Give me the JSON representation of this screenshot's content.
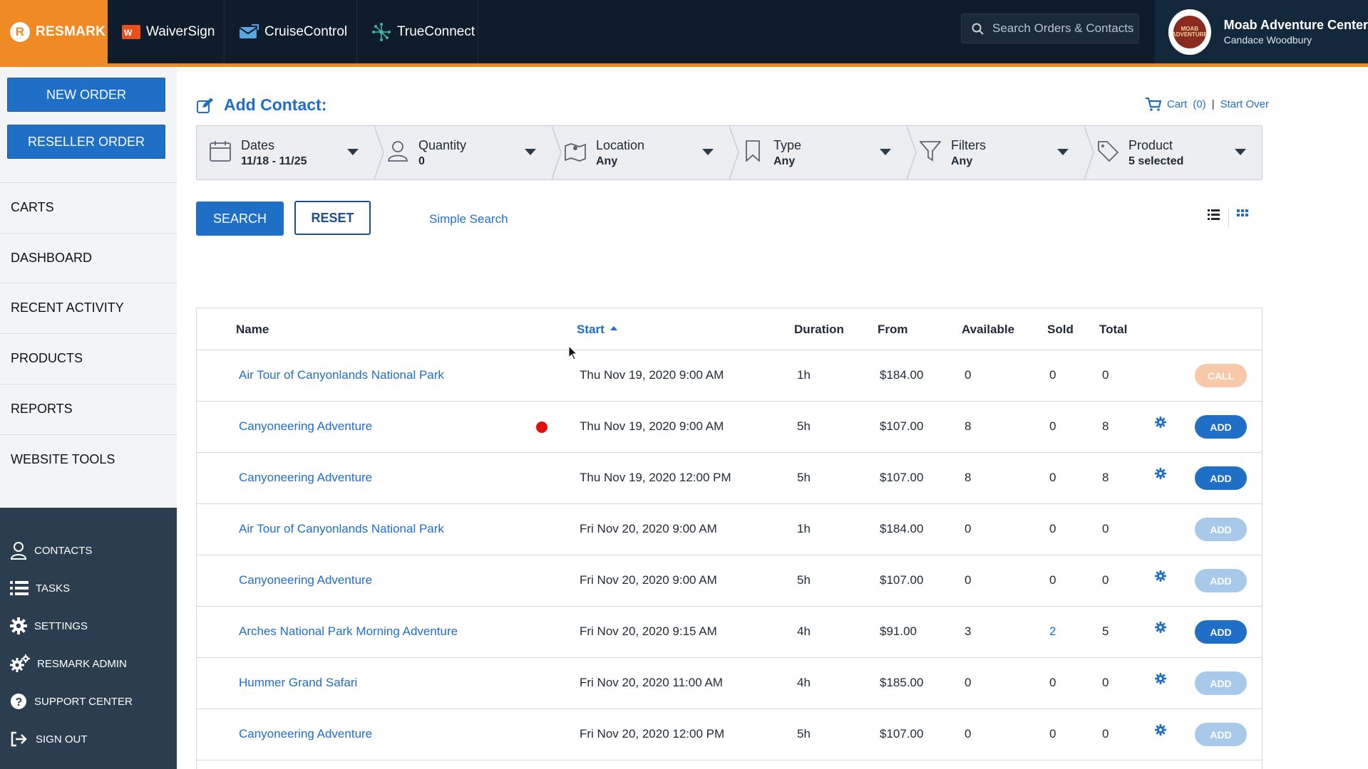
{
  "topbar": {
    "brand": "RESMARK",
    "apps": [
      {
        "label": "WaiverSign"
      },
      {
        "label": "CruiseControl"
      },
      {
        "label": "TrueConnect"
      }
    ],
    "search_placeholder": "Search Orders & Contacts",
    "account": {
      "name": "Moab Adventure Center",
      "user": "Candace Woodbury",
      "logo_text": "MOAB ADVENTURE CENTER"
    }
  },
  "sidebar": {
    "new_order": "NEW ORDER",
    "reseller_order": "RESELLER ORDER",
    "nav": [
      "CARTS",
      "DASHBOARD",
      "RECENT ACTIVITY",
      "PRODUCTS",
      "REPORTS",
      "WEBSITE TOOLS"
    ],
    "bottom": [
      "CONTACTS",
      "TASKS",
      "SETTINGS",
      "RESMARK ADMIN",
      "SUPPORT CENTER",
      "SIGN OUT"
    ]
  },
  "main": {
    "title": "Add Contact:",
    "cart": {
      "label": "Cart",
      "count": "(0)",
      "separator": "|",
      "start_over": "Start Over"
    },
    "filters": [
      {
        "label": "Dates",
        "value": "11/18 - 11/25",
        "icon": "calendar-icon"
      },
      {
        "label": "Quantity",
        "value": "0",
        "icon": "person-icon"
      },
      {
        "label": "Location",
        "value": "Any",
        "icon": "map-icon"
      },
      {
        "label": "Type",
        "value": "Any",
        "icon": "bookmark-icon"
      },
      {
        "label": "Filters",
        "value": "Any",
        "icon": "funnel-icon"
      },
      {
        "label": "Product",
        "value": "5 selected",
        "icon": "tag-icon"
      }
    ],
    "search_btn": "SEARCH",
    "reset_btn": "RESET",
    "simple_search": "Simple Search"
  },
  "table": {
    "headers": {
      "name": "Name",
      "start": "Start",
      "duration": "Duration",
      "from": "From",
      "available": "Available",
      "sold": "Sold",
      "total": "Total"
    },
    "rows": [
      {
        "name": "Air Tour of Canyonlands National Park",
        "start": "Thu Nov 19, 2020 9:00 AM",
        "duration": "1h",
        "from": "$184.00",
        "available": "0",
        "sold": "0",
        "total": "0",
        "action": "CALL",
        "action_state": "call",
        "gear": false,
        "dot": false
      },
      {
        "name": "Canyoneering Adventure",
        "start": "Thu Nov 19, 2020 9:00 AM",
        "duration": "5h",
        "from": "$107.00",
        "available": "8",
        "sold": "0",
        "total": "8",
        "action": "ADD",
        "action_state": "add",
        "gear": true,
        "dot": true
      },
      {
        "name": "Canyoneering Adventure",
        "start": "Thu Nov 19, 2020 12:00 PM",
        "duration": "5h",
        "from": "$107.00",
        "available": "8",
        "sold": "0",
        "total": "8",
        "action": "ADD",
        "action_state": "add",
        "gear": true,
        "dot": false
      },
      {
        "name": "Air Tour of Canyonlands National Park",
        "start": "Fri Nov 20, 2020 9:00 AM",
        "duration": "1h",
        "from": "$184.00",
        "available": "0",
        "sold": "0",
        "total": "0",
        "action": "ADD",
        "action_state": "add-dis",
        "gear": false,
        "dot": false
      },
      {
        "name": "Canyoneering Adventure",
        "start": "Fri Nov 20, 2020 9:00 AM",
        "duration": "5h",
        "from": "$107.00",
        "available": "0",
        "sold": "0",
        "total": "0",
        "action": "ADD",
        "action_state": "add-dis",
        "gear": true,
        "dot": false
      },
      {
        "name": "Arches National Park Morning Adventure",
        "start": "Fri Nov 20, 2020 9:15 AM",
        "duration": "4h",
        "from": "$91.00",
        "available": "3",
        "sold": "2",
        "total": "5",
        "action": "ADD",
        "action_state": "add",
        "gear": true,
        "dot": false
      },
      {
        "name": "Hummer Grand Safari",
        "start": "Fri Nov 20, 2020 11:00 AM",
        "duration": "4h",
        "from": "$185.00",
        "available": "0",
        "sold": "0",
        "total": "0",
        "action": "ADD",
        "action_state": "add-dis",
        "gear": true,
        "dot": false
      },
      {
        "name": "Canyoneering Adventure",
        "start": "Fri Nov 20, 2020 12:00 PM",
        "duration": "5h",
        "from": "$107.00",
        "available": "0",
        "sold": "0",
        "total": "0",
        "action": "ADD",
        "action_state": "add-dis",
        "gear": true,
        "dot": false
      }
    ]
  },
  "colors": {
    "brand_orange": "#f08a24",
    "primary_blue": "#1e6fc5",
    "navy": "#0e1c2b",
    "sidebar_dark": "#2b3e50",
    "call_peach": "#f8c9a9",
    "disabled_blue": "#a9c9ea",
    "status_red": "#e01010"
  }
}
